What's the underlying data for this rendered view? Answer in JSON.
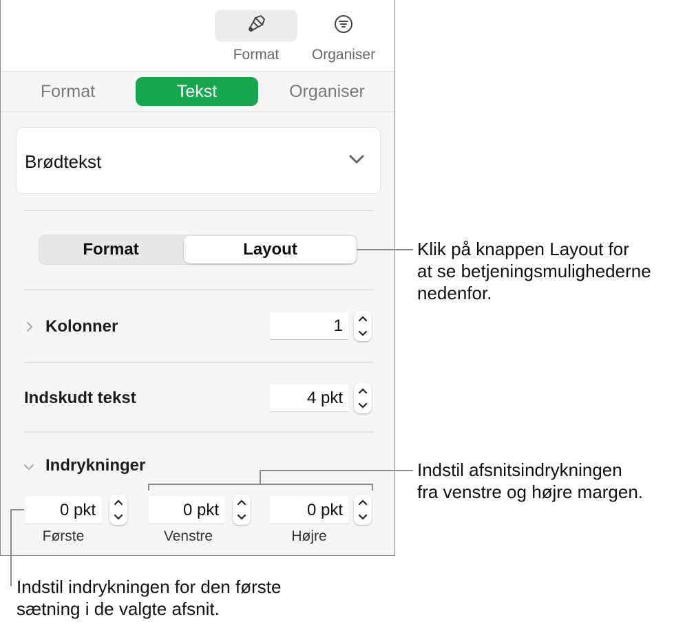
{
  "toolbar": {
    "buttons": [
      {
        "label": "Format",
        "icon": "paintbrush-icon",
        "active": true
      },
      {
        "label": "Organiser",
        "icon": "filter-list-icon",
        "active": false
      }
    ]
  },
  "tabs": [
    {
      "label": "Format",
      "active": false
    },
    {
      "label": "Tekst",
      "active": true
    },
    {
      "label": "Organiser",
      "active": false
    }
  ],
  "paragraph_style": {
    "value": "Brødtekst"
  },
  "segmented": [
    {
      "label": "Format",
      "active": false
    },
    {
      "label": "Layout",
      "active": true
    }
  ],
  "columns": {
    "label": "Kolonner",
    "value": "1",
    "expanded": false
  },
  "inset": {
    "label": "Indskudt tekst",
    "value": "4 pkt"
  },
  "indents": {
    "label": "Indrykninger",
    "expanded": true,
    "fields": [
      {
        "label": "Første",
        "value": "0 pkt"
      },
      {
        "label": "Venstre",
        "value": "0 pkt"
      },
      {
        "label": "Højre",
        "value": "0 pkt"
      }
    ]
  },
  "callouts": {
    "layout": [
      "Klik på knappen Layout for",
      "at se betjeningsmulighederne",
      "nedenfor."
    ],
    "margins": [
      "Indstil afsnitsindrykningen",
      "fra venstre og højre margen."
    ],
    "first": [
      "Indstil indrykningen for den første",
      "sætning i de valgte afsnit."
    ]
  },
  "colors": {
    "accent": "#16a64e"
  }
}
